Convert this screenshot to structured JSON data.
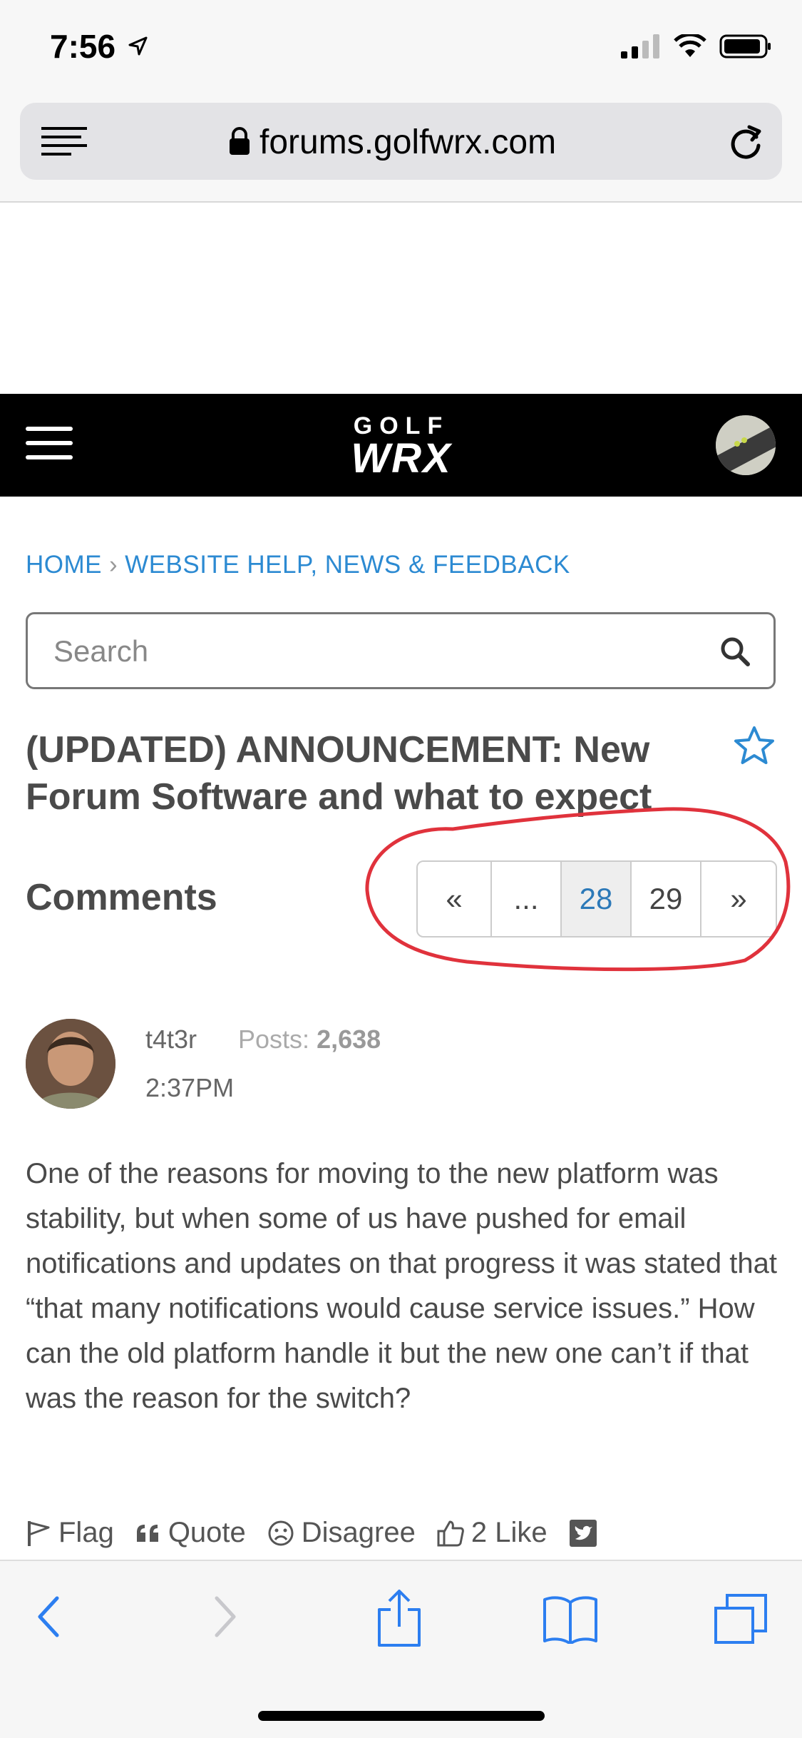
{
  "status_bar": {
    "time": "7:56"
  },
  "browser": {
    "url": "forums.golfwrx.com"
  },
  "site_header": {
    "logo_top": "GOLF",
    "logo_bottom": "WRX"
  },
  "breadcrumb": {
    "home": "HOME",
    "separator": "›",
    "section": "WEBSITE HELP, NEWS & FEEDBACK"
  },
  "search": {
    "placeholder": "Search"
  },
  "thread": {
    "title": "(UPDATED) ANNOUNCEMENT: New Forum Software and what to expect"
  },
  "comments": {
    "label": "Comments",
    "pager": {
      "prev": "«",
      "ellipsis": "...",
      "page_28": "28",
      "page_29": "29",
      "next": "»",
      "current_page": 28
    }
  },
  "post": {
    "author": "t4t3r",
    "posts_label": "Posts:",
    "posts_count": "2,638",
    "time": "2:37PM",
    "body": "One of the reasons for moving to the new platform was stability, but when some of us have pushed for email notifications and updates on that progress it was stated that “that many notifications would cause service issues.” How can the old platform handle it but the new one can’t if that was the reason for the switch?",
    "actions": {
      "flag": "Flag",
      "quote": "Quote",
      "disagree": "Disagree",
      "like": "2 Like"
    }
  },
  "colors": {
    "link": "#2c8ad2",
    "annotation": "#e0323c",
    "header_bg": "#000000"
  },
  "icons": [
    "location-arrow-icon",
    "signal-icon",
    "wifi-icon",
    "battery-icon",
    "reader-icon",
    "lock-icon",
    "reload-icon",
    "search-icon",
    "star-icon",
    "flag-icon",
    "quote-icon",
    "disagree-icon",
    "like-icon",
    "twitter-icon",
    "back-icon",
    "forward-icon",
    "share-icon",
    "bookmarks-icon",
    "tabs-icon"
  ]
}
